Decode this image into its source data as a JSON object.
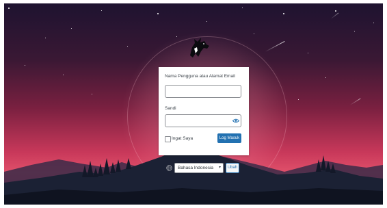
{
  "login_form": {
    "username_label": "Nama Pengguna atau Alamat Email",
    "username_value": "",
    "password_label": "Sandi",
    "password_value": "",
    "remember_label": "Ingat Saya",
    "remember_checked": false,
    "submit_label": "Log Masuk"
  },
  "language_switcher": {
    "selected": "Bahasa Indonesia",
    "change_label": "Ubah"
  },
  "colors": {
    "primary_button": "#2271b1",
    "sky_top": "#1e1330",
    "sky_bottom": "#e0506a",
    "mountains": "#1b2134"
  },
  "icons": {
    "logo": "goat-logo",
    "password_toggle": "eye-icon",
    "language": "globe-icon",
    "dropdown": "chevron-down-icon"
  }
}
